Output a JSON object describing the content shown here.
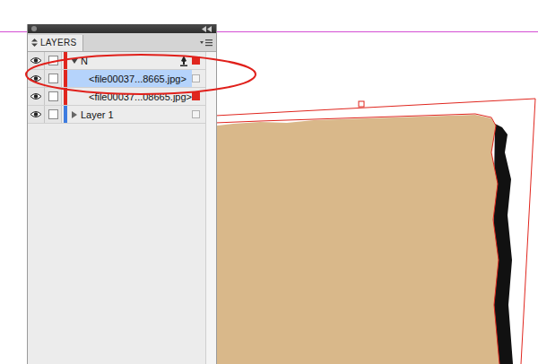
{
  "panel": {
    "title": "LAYERS"
  },
  "layers": [
    {
      "kind": "layer",
      "name": "N",
      "visible": true,
      "locked": false,
      "expanded": true,
      "selected": false,
      "current": true,
      "marked": true,
      "color": "#e0261e"
    },
    {
      "kind": "item",
      "name": "<file00037...8665.jpg>",
      "visible": true,
      "locked": false,
      "expanded": false,
      "selected": true,
      "current": false,
      "marked": false,
      "color": "#e0261e"
    },
    {
      "kind": "item",
      "name": "<file00037...08665.jpg>",
      "visible": true,
      "locked": false,
      "expanded": false,
      "selected": false,
      "current": false,
      "marked": true,
      "color": "#e0261e"
    },
    {
      "kind": "layer",
      "name": "Layer 1",
      "visible": true,
      "locked": false,
      "expanded": false,
      "selected": false,
      "current": false,
      "marked": false,
      "color": "#3d7be0"
    }
  ]
}
